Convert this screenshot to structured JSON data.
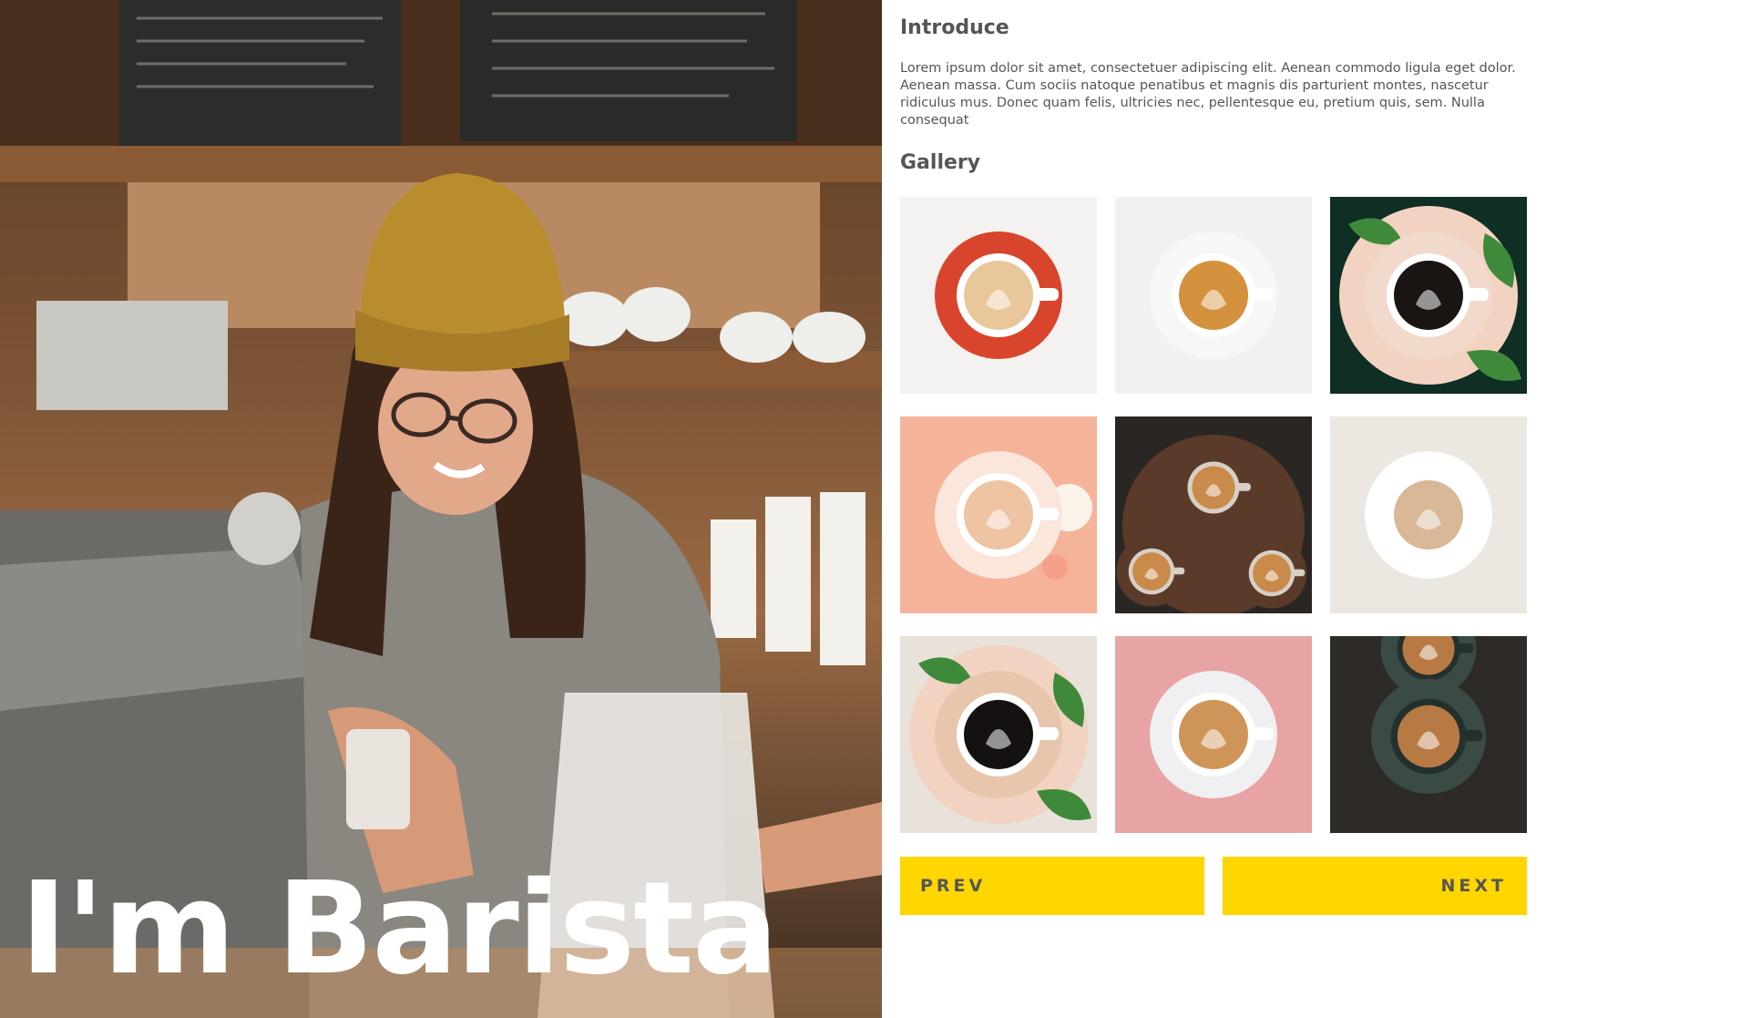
{
  "hero": {
    "title": "I'm Barista",
    "photo": "barista-photo"
  },
  "introduce": {
    "title": "Introduce",
    "text": "Lorem ipsum dolor sit amet, consectetuer adipiscing elit. Aenean commodo ligula eget dolor. Aenean massa. Cum sociis natoque penatibus et magnis dis parturient montes, nascetur ridiculus mus. Donec quam felis, ultricies nec, pellentesque eu, pretium quis, sem. Nulla consequat"
  },
  "gallery": {
    "title": "Gallery",
    "items": [
      {
        "name": "coffee-red-saucer",
        "bg": "#f4f2f0",
        "saucer": "#d9452c",
        "cup": "#ffffff",
        "drink": "#e8c79a"
      },
      {
        "name": "latte-white-saucer",
        "bg": "#f1f1ef",
        "saucer": "#f7f7f7",
        "cup": "#ffffff",
        "drink": "#d4923e"
      },
      {
        "name": "black-coffee-leaves",
        "bg": "#0f2e24",
        "saucer": "#f1d9cc",
        "cup": "#ffffff",
        "drink": "#1a1512"
      },
      {
        "name": "cappuccino-peach",
        "bg": "#f5b49a",
        "saucer": "#fbe6dc",
        "cup": "#ffffff",
        "drink": "#eec4a2"
      },
      {
        "name": "three-lattes-wood",
        "bg": "#2a2624",
        "saucer": "#5a3a28",
        "cup": "#d8cfc6",
        "drink": "#c98a4a"
      },
      {
        "name": "cappuccino-white-linen",
        "bg": "#ece7e0",
        "saucer": "#ffffff",
        "cup": "#ffffff",
        "drink": "#d8b896"
      },
      {
        "name": "black-coffee-enjoy",
        "bg": "#e8e2da",
        "saucer": "#e7c6ad",
        "cup": "#ffffff",
        "drink": "#141110"
      },
      {
        "name": "latte-pink-table",
        "bg": "#e8a4a4",
        "saucer": "#f0f0f2",
        "cup": "#ffffff",
        "drink": "#cf9458"
      },
      {
        "name": "latte-dark-wood",
        "bg": "#2e2a26",
        "saucer": "#3a4a44",
        "cup": "#24302c",
        "drink": "#b87a44"
      }
    ]
  },
  "pager": {
    "prev": "PREV",
    "next": "NEXT"
  },
  "colors": {
    "accent": "#ffd600",
    "text": "#555555",
    "background": "#ffffff"
  }
}
